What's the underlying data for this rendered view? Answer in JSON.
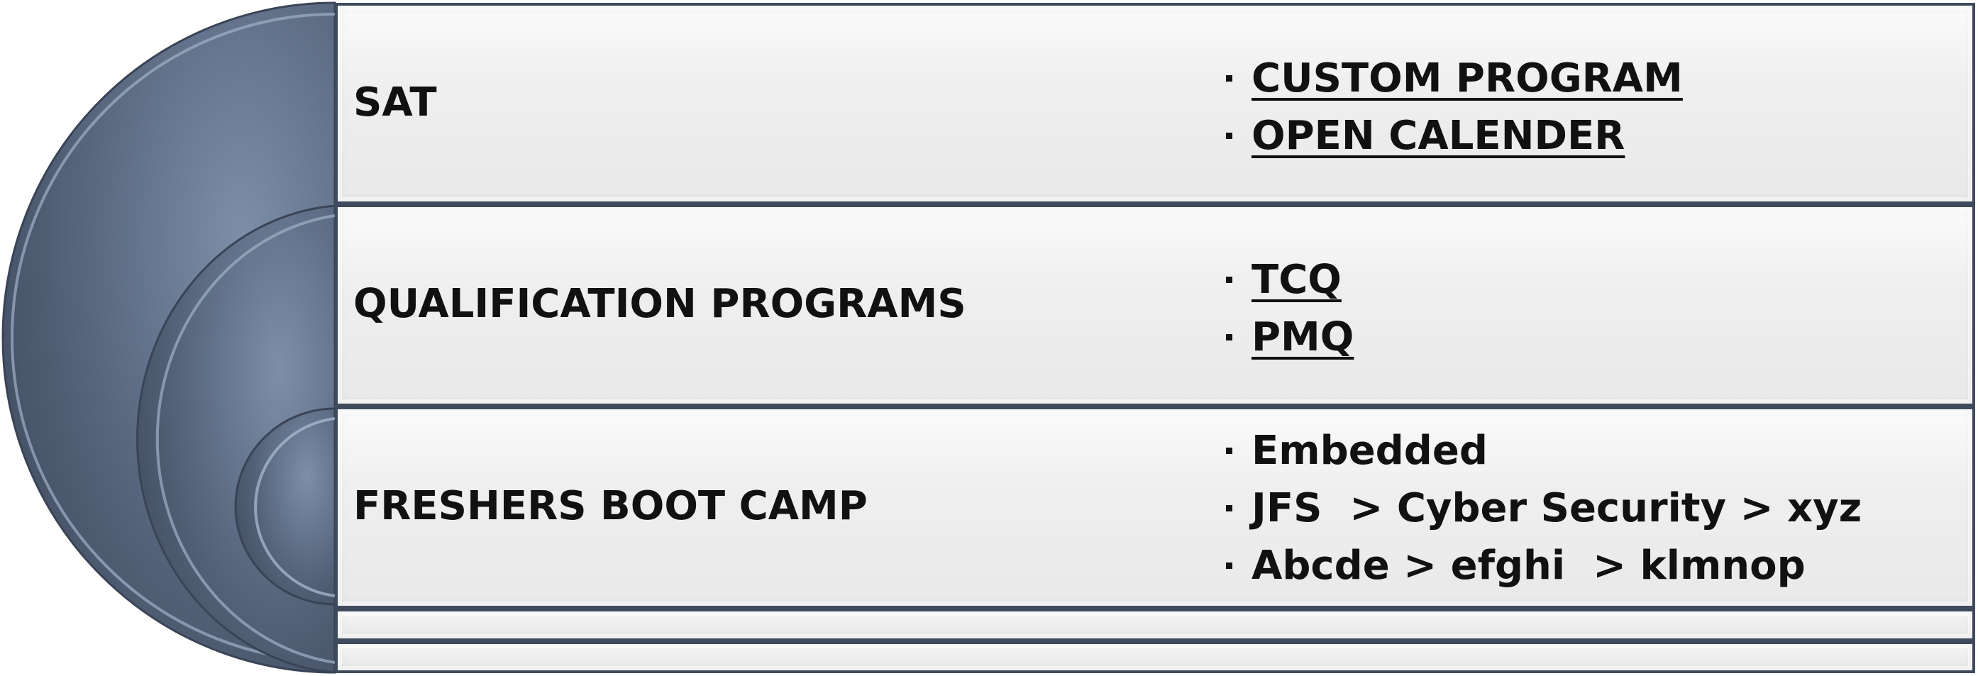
{
  "rows": [
    {
      "title": "SAT",
      "items": [
        "CUSTOM PROGRAM",
        "OPEN CALENDER"
      ]
    },
    {
      "title": "QUALIFICATION PROGRAMS",
      "items": [
        "TCQ",
        "PMQ"
      ]
    },
    {
      "title": "FRESHERS BOOT CAMP",
      "items": [
        "Embedded",
        "JFS  > Cyber Security > xyz",
        "Abcde > efghi  > klmnop"
      ]
    }
  ],
  "colors": {
    "arc": "#4f5e74",
    "arc_light": "#8b9bb2",
    "border": "#3f4a5c",
    "panel": "#eeeeee"
  }
}
